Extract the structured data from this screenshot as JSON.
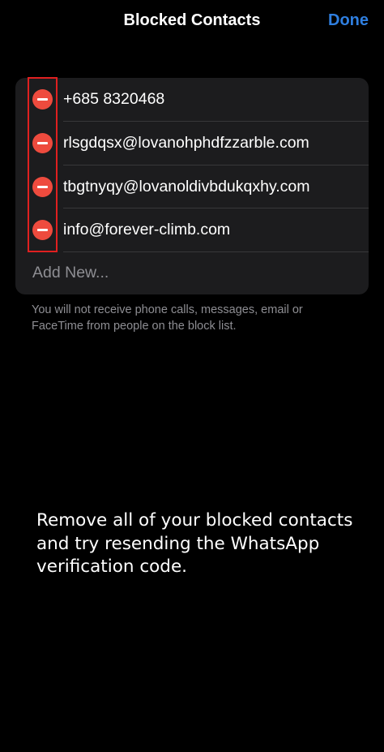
{
  "nav": {
    "title": "Blocked Contacts",
    "done_label": "Done"
  },
  "blocked_list": {
    "contacts": [
      "+685 8320468",
      "rlsgdqsx@lovanohphdfzzarble.com",
      "tbgtnyqy@lovanoldivbdukqxhy.com",
      "info@forever-climb.com"
    ],
    "delete_icon": "minus-circle-icon",
    "add_new_placeholder": "Add New..."
  },
  "footer_note": "You will not receive phone calls, messages, email or FaceTime from people on the block list.",
  "instruction": "Remove all of your blocked contacts and try resending the WhatsApp verification code.",
  "colors": {
    "accent": "#2f7fe0",
    "delete": "#ee4b3e",
    "highlight": "#e02020",
    "card_background": "#1c1c1e",
    "secondary_text": "#8e8e93"
  }
}
